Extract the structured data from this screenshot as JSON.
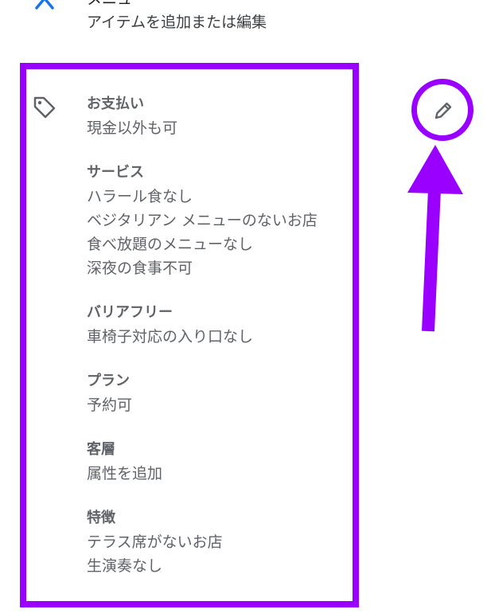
{
  "header": {
    "title": "メニュー",
    "subtitle": "アイテムを追加または編集"
  },
  "attributes": {
    "sections": [
      {
        "title": "お支払い",
        "items": [
          "現金以外も可"
        ]
      },
      {
        "title": "サービス",
        "items": [
          "ハラール食なし",
          "ベジタリアン メニューのないお店",
          "食べ放題のメニューなし",
          "深夜の食事不可"
        ]
      },
      {
        "title": "バリアフリー",
        "items": [
          "車椅子対応の入り口なし"
        ]
      },
      {
        "title": "プラン",
        "items": [
          "予約可"
        ]
      },
      {
        "title": "客層",
        "items": [
          "属性を追加"
        ]
      },
      {
        "title": "特徴",
        "items": [
          "テラス席がないお店",
          "生演奏なし"
        ]
      }
    ]
  },
  "icons": {
    "menu": "close-x-icon",
    "tag": "tag-icon",
    "edit": "pencil-icon"
  },
  "colors": {
    "annotation": "#9900ff",
    "menu_icon": "#1a73e8",
    "text_muted": "#5f6368"
  }
}
